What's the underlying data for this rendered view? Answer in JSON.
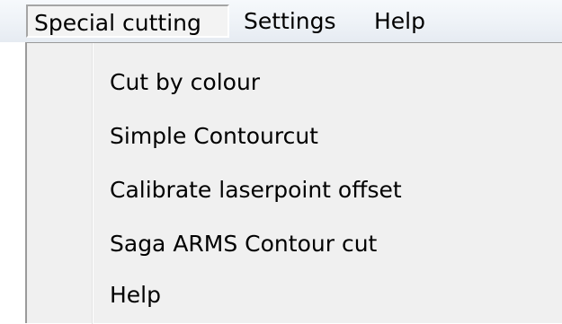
{
  "menubar": {
    "items": [
      {
        "label": "Special cutting"
      },
      {
        "label": "Settings"
      },
      {
        "label": "Help"
      }
    ]
  },
  "dropdown": {
    "items": [
      {
        "label": "Cut by colour"
      },
      {
        "label": "Simple Contourcut"
      },
      {
        "label": "Calibrate laserpoint offset"
      },
      {
        "label": "Saga ARMS Contour cut"
      },
      {
        "label": "Help"
      }
    ]
  }
}
